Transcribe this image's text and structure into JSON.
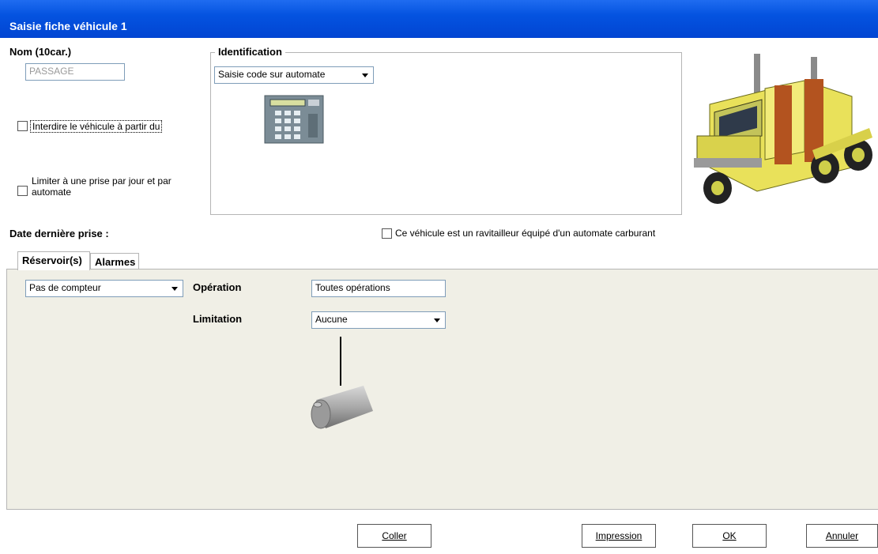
{
  "window": {
    "title": "Saisie fiche véhicule 1"
  },
  "name_field": {
    "label": "Nom (10car.)",
    "value": "PASSAGE"
  },
  "identification": {
    "legend": "Identification",
    "mode": "Saisie code sur automate"
  },
  "checkboxes": {
    "interdire": "Interdire le véhicule à partir du",
    "limiter_line1": "Limiter à une prise par jour et par",
    "limiter_line2": "automate",
    "ravitailleur": "Ce véhicule est un ravitailleur équipé d'un automate carburant"
  },
  "date_derniere_prise": "Date dernière prise :",
  "tabs": [
    {
      "label": "Réservoir(s)"
    },
    {
      "label": "Alarmes"
    }
  ],
  "reservoir": {
    "compteur": "Pas de compteur",
    "operation_label": "Opération",
    "operation_value": "Toutes opérations",
    "limitation_label": "Limitation",
    "limitation_value": "Aucune"
  },
  "buttons": {
    "coller": "Coller",
    "impression": "Impression",
    "ok": "OK",
    "annuler": "Annuler"
  },
  "icons": {
    "truck": "truck-icon",
    "keypad": "keypad-terminal-icon",
    "tank": "fuel-tank-icon"
  }
}
